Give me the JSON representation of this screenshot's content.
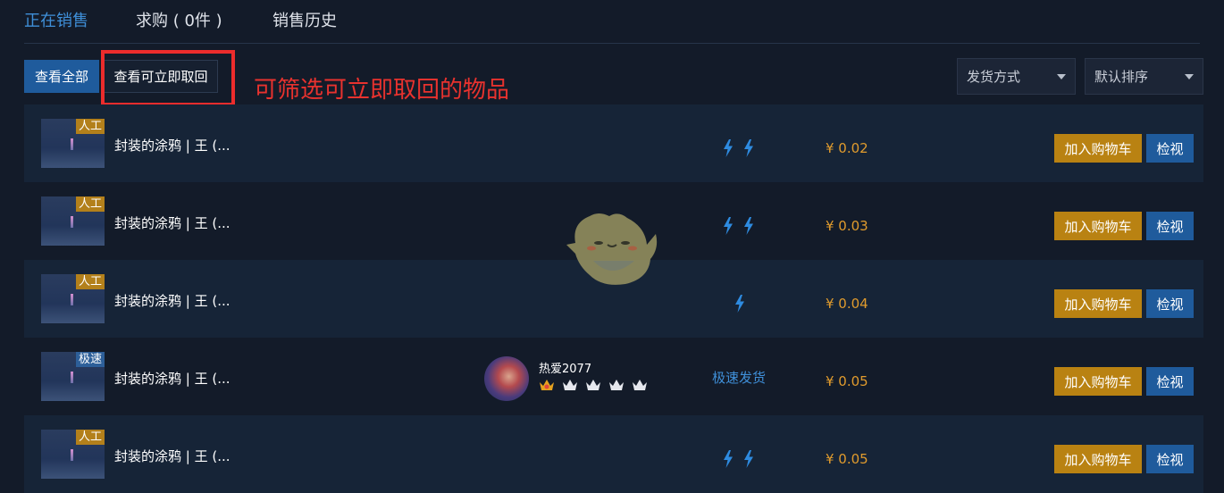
{
  "tabs": [
    {
      "label": "正在销售",
      "active": true
    },
    {
      "label": "求购 ( 0件 )",
      "active": false
    },
    {
      "label": "销售历史",
      "active": false
    }
  ],
  "filters": {
    "view_all": "查看全部",
    "instant_pickup": "查看可立即取回",
    "annotation": "可筛选可立即取回的物品",
    "delivery_select": "发货方式",
    "sort_select": "默认排序"
  },
  "rows": [
    {
      "tag": "人工",
      "tag_type": "manual",
      "name": "封装的涂鸦 | 王 (...",
      "bolts": 2,
      "price": "¥ 0.02",
      "cart": "加入购物车",
      "view": "检视"
    },
    {
      "tag": "人工",
      "tag_type": "manual",
      "name": "封装的涂鸦 | 王 (...",
      "bolts": 2,
      "price": "¥ 0.03",
      "cart": "加入购物车",
      "view": "检视"
    },
    {
      "tag": "人工",
      "tag_type": "manual",
      "name": "封装的涂鸦 | 王 (...",
      "bolts": 1,
      "price": "¥ 0.04",
      "cart": "加入购物车",
      "view": "检视"
    },
    {
      "tag": "极速",
      "tag_type": "fast",
      "name": "封装的涂鸦 | 王 (...",
      "seller": "热爱2077",
      "delivery": "极速发货",
      "price": "¥ 0.05",
      "cart": "加入购物车",
      "view": "检视"
    },
    {
      "tag": "人工",
      "tag_type": "manual",
      "name": "封装的涂鸦 | 王 (...",
      "bolts": 2,
      "price": "¥ 0.05",
      "cart": "加入购物车",
      "view": "检视"
    }
  ],
  "colors": {
    "accent": "#3f8fd8",
    "price": "#e09b2d",
    "cart": "#b98212",
    "view": "#1f5b9c",
    "highlight": "#ec2c2c"
  }
}
